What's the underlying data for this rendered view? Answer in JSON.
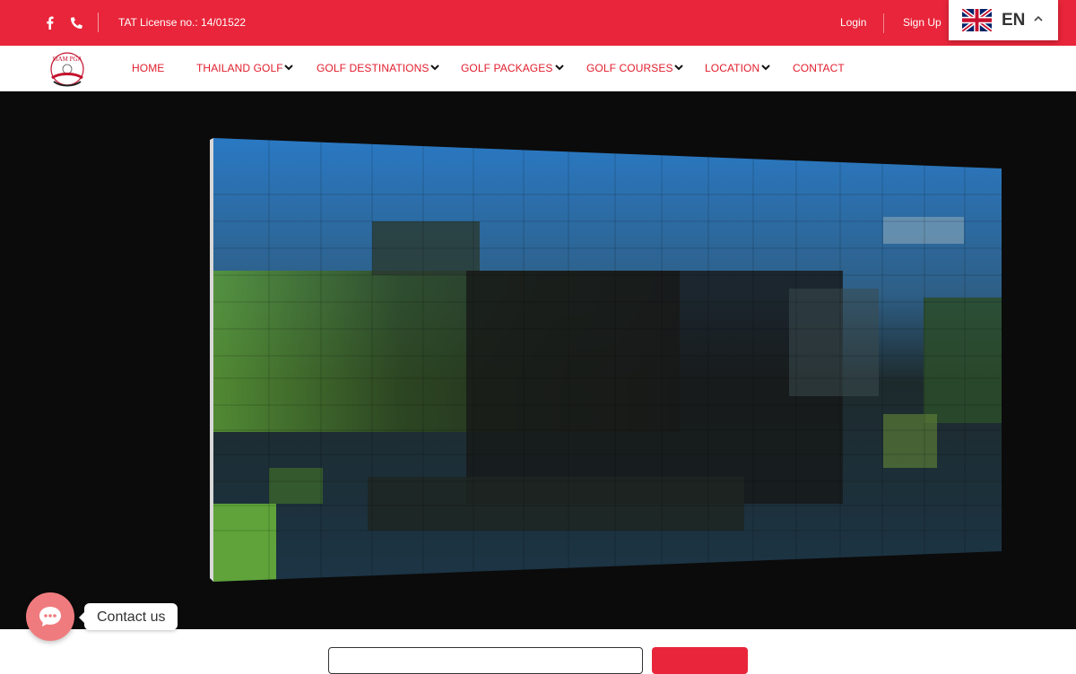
{
  "topbar": {
    "social": [
      {
        "name": "facebook-icon"
      },
      {
        "name": "phone-icon"
      }
    ],
    "license": "TAT License no.: 14/01522",
    "login": "Login",
    "signup": "Sign Up",
    "language": {
      "code": "EN",
      "flag": "uk-flag-icon"
    },
    "colors": {
      "bar": "#e8253a"
    }
  },
  "nav": {
    "items": [
      {
        "label": "HOME",
        "has_dropdown": false
      },
      {
        "label": "THAILAND GOLF",
        "has_dropdown": true
      },
      {
        "label": "GOLF DESTINATIONS",
        "has_dropdown": true
      },
      {
        "label": "GOLF PACKAGES",
        "has_dropdown": true
      },
      {
        "label": "GOLF COURSES",
        "has_dropdown": true
      },
      {
        "label": "LOCATION",
        "has_dropdown": true
      },
      {
        "label": "CONTACT",
        "has_dropdown": false
      }
    ],
    "accent": "#e11d2c"
  },
  "contact_widget": {
    "label": "Contact us",
    "color": "#f07b7e"
  }
}
